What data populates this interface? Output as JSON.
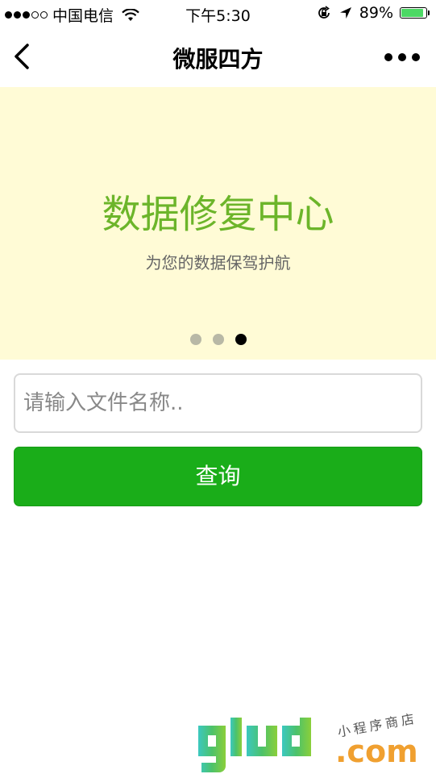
{
  "status_bar": {
    "carrier": "中国电信",
    "time": "下午5:30",
    "battery_percent": "89%",
    "battery_level": 0.89,
    "signal_filled": 3,
    "signal_total": 5,
    "icons": [
      "signal-icon",
      "wifi-icon",
      "orientation-lock-icon",
      "location-icon",
      "battery-icon"
    ]
  },
  "nav": {
    "title": "微服四方",
    "back_icon": "chevron-left-icon",
    "more_icon": "more-dots-icon"
  },
  "banner": {
    "title": "数据修复中心",
    "subtitle": "为您的数据保驾护航",
    "background": "#fffbd6",
    "title_color": "#6cb52a",
    "slides_total": 3,
    "active_slide": 3
  },
  "search": {
    "placeholder": "请输入文件名称..",
    "value": ""
  },
  "query_button": {
    "label": "查询",
    "color": "#1aad19"
  },
  "watermark": {
    "logo_text": "glud",
    "tagline": "小程序商店",
    "domain": ".com"
  }
}
